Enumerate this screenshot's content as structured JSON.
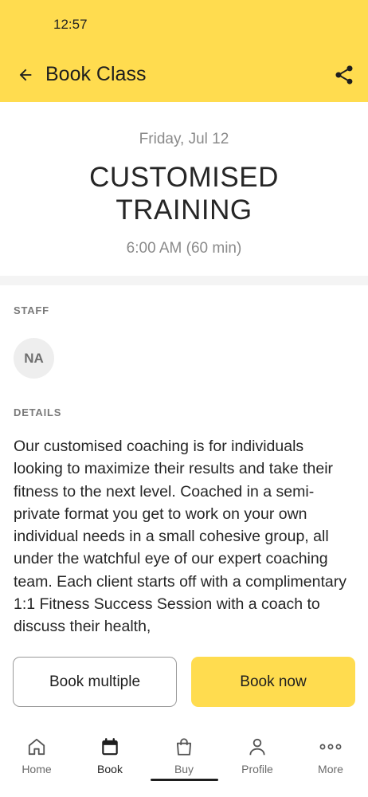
{
  "status_bar": {
    "time": "12:57"
  },
  "app_bar": {
    "title": "Book Class",
    "back_icon": "arrow-left-icon",
    "share_icon": "share-icon"
  },
  "class": {
    "date": "Friday, Jul 12",
    "name": "CUSTOMISED TRAINING",
    "time": "6:00 AM (60 min)"
  },
  "staff": {
    "label": "STAFF",
    "initials": "NA"
  },
  "details": {
    "label": "DETAILS",
    "text": "Our customised coaching is for individuals looking to maximize their results and take their fitness to the next level. Coached in a semi-private format you get to work on your own individual needs in a small cohesive group, all under the watchful eye of our expert coaching team. Each client starts off with a complimentary 1:1 Fitness Success Session with a coach to discuss their health,"
  },
  "actions": {
    "book_multiple": "Book multiple",
    "book_now": "Book now"
  },
  "bottom_nav": [
    {
      "label": "Home",
      "icon": "home-icon",
      "active": false
    },
    {
      "label": "Book",
      "icon": "calendar-icon",
      "active": true
    },
    {
      "label": "Buy",
      "icon": "shopping-bag-icon",
      "active": false
    },
    {
      "label": "Profile",
      "icon": "person-icon",
      "active": false
    },
    {
      "label": "More",
      "icon": "more-dots-icon",
      "active": false
    }
  ],
  "colors": {
    "accent": "#ffdc4f",
    "text": "#262626",
    "muted": "#8a8a8a"
  }
}
